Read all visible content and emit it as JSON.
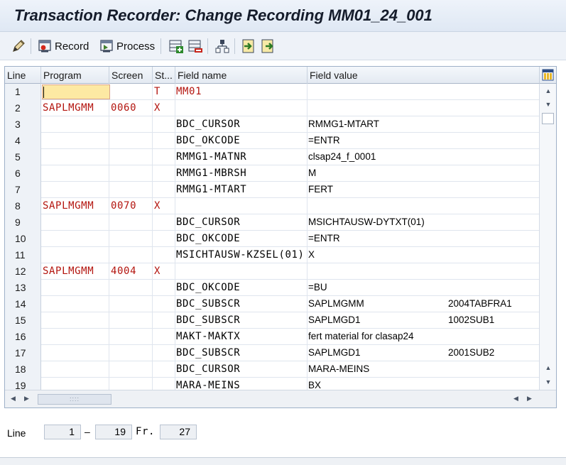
{
  "title": "Transaction Recorder: Change Recording MM01_24_001",
  "toolbar": {
    "record_label": "Record",
    "process_label": "Process"
  },
  "columns": {
    "line": "Line",
    "program": "Program",
    "screen": "Screen",
    "start": "St...",
    "field_name": "Field name",
    "field_value": "Field value"
  },
  "rows": [
    {
      "line": "1",
      "program": "",
      "screen": "",
      "st": "T",
      "field_name": "MM01",
      "field_value": "",
      "field_value_2": ""
    },
    {
      "line": "2",
      "program": "SAPLMGMM",
      "screen": "0060",
      "st": "X",
      "field_name": "",
      "field_value": "",
      "field_value_2": ""
    },
    {
      "line": "3",
      "program": "",
      "screen": "",
      "st": "",
      "field_name": "BDC_CURSOR",
      "field_value": "RMMG1-MTART",
      "field_value_2": ""
    },
    {
      "line": "4",
      "program": "",
      "screen": "",
      "st": "",
      "field_name": "BDC_OKCODE",
      "field_value": "=ENTR",
      "field_value_2": ""
    },
    {
      "line": "5",
      "program": "",
      "screen": "",
      "st": "",
      "field_name": "RMMG1-MATNR",
      "field_value": "clsap24_f_0001",
      "field_value_2": ""
    },
    {
      "line": "6",
      "program": "",
      "screen": "",
      "st": "",
      "field_name": "RMMG1-MBRSH",
      "field_value": "M",
      "field_value_2": ""
    },
    {
      "line": "7",
      "program": "",
      "screen": "",
      "st": "",
      "field_name": "RMMG1-MTART",
      "field_value": "FERT",
      "field_value_2": ""
    },
    {
      "line": "8",
      "program": "SAPLMGMM",
      "screen": "0070",
      "st": "X",
      "field_name": "",
      "field_value": "",
      "field_value_2": ""
    },
    {
      "line": "9",
      "program": "",
      "screen": "",
      "st": "",
      "field_name": "BDC_CURSOR",
      "field_value": "MSICHTAUSW-DYTXT(01)",
      "field_value_2": ""
    },
    {
      "line": "10",
      "program": "",
      "screen": "",
      "st": "",
      "field_name": "BDC_OKCODE",
      "field_value": "=ENTR",
      "field_value_2": ""
    },
    {
      "line": "11",
      "program": "",
      "screen": "",
      "st": "",
      "field_name": "MSICHTAUSW-KZSEL(01)",
      "field_value": "X",
      "field_value_2": ""
    },
    {
      "line": "12",
      "program": "SAPLMGMM",
      "screen": "4004",
      "st": "X",
      "field_name": "",
      "field_value": "",
      "field_value_2": ""
    },
    {
      "line": "13",
      "program": "",
      "screen": "",
      "st": "",
      "field_name": "BDC_OKCODE",
      "field_value": "=BU",
      "field_value_2": ""
    },
    {
      "line": "14",
      "program": "",
      "screen": "",
      "st": "",
      "field_name": "BDC_SUBSCR",
      "field_value": "SAPLMGMM",
      "field_value_2": "2004TABFRA1"
    },
    {
      "line": "15",
      "program": "",
      "screen": "",
      "st": "",
      "field_name": "BDC_SUBSCR",
      "field_value": "SAPLMGD1",
      "field_value_2": "1002SUB1"
    },
    {
      "line": "16",
      "program": "",
      "screen": "",
      "st": "",
      "field_name": "MAKT-MAKTX",
      "field_value": "fert material for clasap24",
      "field_value_2": ""
    },
    {
      "line": "17",
      "program": "",
      "screen": "",
      "st": "",
      "field_name": "BDC_SUBSCR",
      "field_value": "SAPLMGD1",
      "field_value_2": "2001SUB2"
    },
    {
      "line": "18",
      "program": "",
      "screen": "",
      "st": "",
      "field_name": "BDC_CURSOR",
      "field_value": "MARA-MEINS",
      "field_value_2": ""
    },
    {
      "line": "19",
      "program": "",
      "screen": "",
      "st": "",
      "field_name": "MARA-MEINS",
      "field_value": "BX",
      "field_value_2": ""
    }
  ],
  "line_nav": {
    "label": "Line",
    "from": "1",
    "separator": "–",
    "to": "19",
    "of_label": "Fr.",
    "total": "27"
  },
  "colors": {
    "accent_red": "#b3140e",
    "edit_cell": "#fde9a3"
  },
  "icons": [
    "edit-pencil-icon",
    "record-icon",
    "process-icon",
    "insert-row-icon",
    "delete-row-icon",
    "hierarchy-icon",
    "import-icon",
    "export-icon",
    "grid-config-icon"
  ]
}
